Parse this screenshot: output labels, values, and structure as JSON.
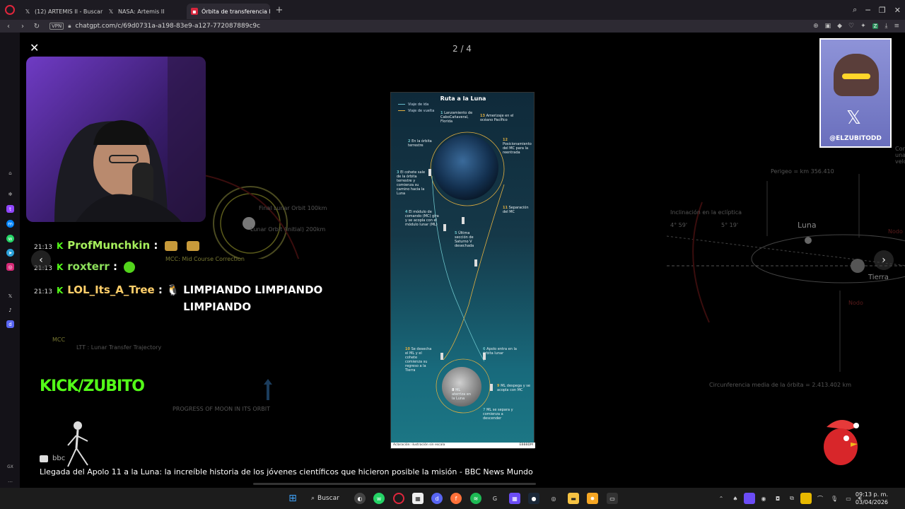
{
  "tabs": [
    {
      "label": "(12) ARTEMIS II - Buscar",
      "icon": "x-logo-icon"
    },
    {
      "label": "NASA: Artemis II",
      "icon": "x-logo-icon"
    },
    {
      "label": "Órbita de transferencia lu",
      "icon": "page-icon"
    }
  ],
  "address": {
    "vpn": "VPN",
    "url": "chatgpt.com/c/69d0731a-a198-83e9-a127-772087889c9c"
  },
  "viewer": {
    "counter": "2 / 4",
    "caption_source": "bbc",
    "caption": "Llegada del Apolo 11 a la Luna: la increíble historia de los jóvenes científicos que hicieron posible la misión - BBC News Mundo"
  },
  "infographic": {
    "title": "Ruta a la Luna",
    "legend_out": "Viaje de ida",
    "legend_back": "Viaje de vuelta",
    "notes": [
      {
        "n": "1",
        "text": "Lanzamiento de CaboCañaveral, Florida"
      },
      {
        "n": "2",
        "text": "En la órbita terrestre"
      },
      {
        "n": "3",
        "text": "El cohete sale de la órbita terrestre y comienza su camino hacia la Luna"
      },
      {
        "n": "4",
        "text": "El módulo de comando (MC) gira y se acopla con el módulo lunar (ML)"
      },
      {
        "n": "5",
        "text": "Última sección de Saturno V desechada"
      },
      {
        "n": "6",
        "text": "Apolo entra en la órbita lunar"
      },
      {
        "n": "7",
        "text": "ML se separa y comienza a descender"
      },
      {
        "n": "8",
        "text": "ML aterriza en la Luna"
      },
      {
        "n": "9",
        "text": "ML despega y se acopla con MC"
      },
      {
        "n": "10",
        "text": "Se desecha el ML y el cohete comienza su regreso a la Tierra"
      },
      {
        "n": "11",
        "text": "Separación del MC"
      },
      {
        "n": "12",
        "text": "Posicionamiento del MC para la reentrada"
      },
      {
        "n": "13",
        "text": "Amerizaje en el océano Pacífico"
      }
    ],
    "footer_left": "Aclaración: ilustración sin escala",
    "footer_right": "EBBBDM"
  },
  "background_left": {
    "final_orbit": "Final Lunar Orbit 100km",
    "initial_orbit": "Lunar Orbit (initial) 200km",
    "mcc": "MCC: Mid Course Correction",
    "mcc_short": "MCC",
    "ltt": "LTT : Lunar Transfer Trajectory",
    "progress": "PROGRESS OF MOON IN ITS ORBIT"
  },
  "background_right": {
    "perigee": "Perigeo = km 356.410",
    "inclination": "Inclinación en la eclíptica",
    "angle_1": "4° 59'",
    "angle_2": "5° 19'",
    "moon": "Luna",
    "earth": "Tierra",
    "node_1": "Nodo",
    "node_2": "Nodo",
    "circumference": "Circunferencia media de la órbita = 2.413.402 km",
    "velocity": "Con una veloc"
  },
  "chat": [
    {
      "time": "21:13",
      "user": "ProfMunchkin",
      "message": "",
      "color": "#a6f05c"
    },
    {
      "time": "21:13",
      "user": "roxterr",
      "message": "",
      "color": "#8ce05a"
    },
    {
      "time": "21:13",
      "user": "LOL_Its_A_Tree",
      "message": "LIMPIANDO LIMPIANDO LIMPIANDO",
      "color": "#ffcf6a"
    }
  ],
  "kick_brand": "KICK/ZUBITO",
  "x_badge": "@ELZUBITODD",
  "taskbar": {
    "search": "Buscar",
    "time": "09:13 p. m.",
    "date": "03/04/2026"
  },
  "colors": {
    "accent": "#e0263c",
    "kick": "#53fc18",
    "tab_active": "#2d2a33"
  }
}
